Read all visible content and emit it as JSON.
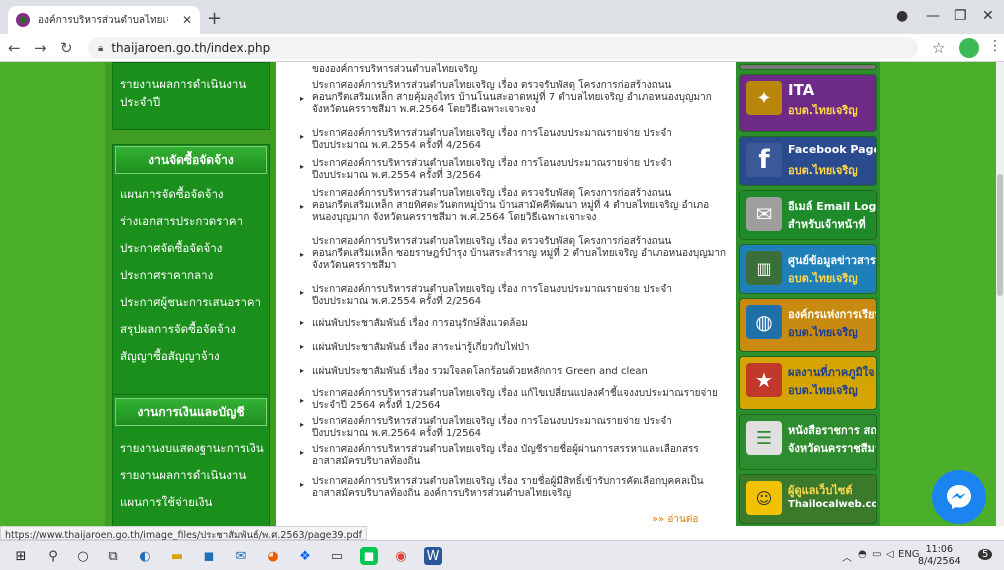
{
  "browser": {
    "tab_title": "องค์การบริหารส่วนตำบลไทยเจริญ อำเ...",
    "url": "thaijaroen.go.th/index.php",
    "hover_link": "https://www.thaijaroen.go.th/image_files/ประชาสัมพันธ์/พ.ศ.2563/page39.pdf"
  },
  "sidebar": {
    "top_item": {
      "line1": "รายงานผลการดำเนินงาน",
      "line2": "ประจำปี"
    },
    "procurement_header": "งานจัดซื้อจัดจ้าง",
    "procurement_items": [
      "แผนการจัดซื้อจัดจ้าง",
      "ร่างเอกสารประกวดราคา",
      "ประกาศจัดซื้อจัดจ้าง",
      "ประกาศราคากลาง",
      "ประกาศผู้ชนะการเสนอราคา",
      "สรุปผลการจัดซื้อจัดจ้าง",
      "สัญญาซื้อสัญญาจ้าง"
    ],
    "finance_header": "งานการเงินและบัญชี",
    "finance_items": [
      "รายงานงบแสดงฐานะการเงิน",
      "รายงานผลการดำเนินงาน",
      "แผนการใช้จ่ายเงิน"
    ]
  },
  "news": {
    "top_line": "ขององค์การบริหารส่วนตำบลไทยเจริญ",
    "items": [
      "ประกาศองค์การบริหารส่วนตำบลไทยเจริญ เรื่อง ตรวจรับพัสดุ โครงการก่อสร้างถนน คอนกรีตเสริมเหล็ก สายคุ้มลุงไทร บ้านโนนสะอาดหมู่ที่ 7 ตำบลไทยเจริญ อำเภอหนองบุญมาก จังหวัดนครราชสีมา พ.ศ.2564 โดยวิธีเฉพาะเจาะจง",
      "ประกาศองค์การบริหารส่วนตำบลไทยเจริญ เรื่อง การโอนงบประมาณรายจ่าย ประจำปีงบประมาณ พ.ศ.2554 ครั้งที่ 4/2564",
      "ประกาศองค์การบริหารส่วนตำบลไทยเจริญ เรื่อง การโอนงบประมาณรายจ่าย ประจำปีงบประมาณ พ.ศ.2554 ครั้งที่ 3/2564",
      "ประกาศองค์การบริหารส่วนตำบลไทยเจริญ เรื่อง ตรวจรับพัสดุ โครงการก่อสร้างถนน คอนกรีตเสริมเหล็ก สายทิศตะวันตกหมู่บ้าน บ้านสามัคคีพัฒนา หมู่ที่ 4 ตำบลไทยเจริญ อำเภอหนองบุญมาก จังหวัดนครราชสีมา พ.ศ.2564 โดยวิธีเฉพาะเจาะจง",
      "ประกาศองค์การบริหารส่วนตำบลไทยเจริญ เรื่อง ตรวจรับพัสดุ โครงการก่อสร้างถนน คอนกรีตเสริมเหล็ก ซอยราษฎร์บำรุง บ้านสระสำราญ หมู่ที่ 2 ตำบลไทยเจริญ อำเภอหนองบุญมาก จังหวัดนครราชสีมา",
      "ประกาศองค์การบริหารส่วนตำบลไทยเจริญ เรื่อง การโอนงบประมาณรายจ่าย ประจำปีงบประมาณ พ.ศ.2554 ครั้งที่ 2/2564",
      "แผ่นพับประชาสัมพันธ์ เรื่อง การอนุรักษ์สิ่งแวดล้อม",
      "แผ่นพับประชาสัมพันธ์ เรื่อง สาระน่ารู้เกี่ยวกับไฟป่า",
      "แผ่นพับประชาสัมพันธ์ เรื่อง รวมใจลดโลกร้อนด้วยหลักการ Green and clean",
      "ประกาศองค์การบริหารส่วนตำบลไทยเจริญ เรื่อง แก้ไขเปลี่ยนแปลงคำชี้แจงงบประมาณรายจ่าย ประจำปี 2564 ครั้งที่ 1/2564",
      "ประกาศองค์การบริหารส่วนตำบลไทยเจริญ เรื่อง การโอนงบประมาณรายจ่าย ประจำปีงบประมาณ พ.ศ.2564 ครั้งที่ 1/2564",
      "ประกาศองค์การบริหารส่วนตำบลไทยเจริญ เรื่อง บัญชีรายชื่อผู้ผ่านการสรรหาและเลือกสรรอาสาสมัครบริบาลท้องถิ่น",
      "ประกาศองค์การบริหารส่วนตำบลไทยเจริญ เรื่อง รายชื่อผู้มีสิทธิ์เข้ารับการคัดเลือกบุคคลเป็นอาสาสมัครบริบาลท้องถิ่น องค์การบริหารส่วนตำบลไทยเจริญ"
    ],
    "read_more": "»» อ่านต่อ"
  },
  "banners": [
    {
      "line1": "ITA",
      "line2": "อบต.ไทยเจริญ",
      "bg": "#6d2a86",
      "icon": "emblem-icon"
    },
    {
      "line1": "Facebook Page",
      "line2": "อบต.ไทยเจริญ",
      "bg": "#2a4c8f",
      "icon": "facebook-icon"
    },
    {
      "line1": "อีเมล์ Email Login",
      "line2": "สำหรับเจ้าหน้าที่",
      "bg": "#1f8a2a",
      "icon": "mail-icon"
    },
    {
      "line1": "ศูนย์ข้อมูลข่าวสาร",
      "line2": "อบต.ไทยเจริญ",
      "bg": "#1f7fb8",
      "icon": "binder-icon"
    },
    {
      "line1": "องค์กรแห่งการเรียนรู้",
      "line2": "อบต.ไทยเจริญ",
      "bg": "#c98a12",
      "icon": "globe-icon"
    },
    {
      "line1": "ผลงานที่ภาคภูมิใจ",
      "line2": "อบต.ไทยเจริญ",
      "bg": "#d4a400",
      "icon": "medal-icon"
    },
    {
      "line1": "หนังสือราชการ สถ.",
      "line2": "จังหวัดนครราชสีมา",
      "bg": "#2e8b2e",
      "icon": "document-icon"
    },
    {
      "line1": "ผู้ดูแลเว็บไซต์",
      "line2": "Thailocalweb.com",
      "bg": "#3a7a2a",
      "icon": "admin-icon"
    }
  ],
  "taskbar": {
    "lang": "ENG",
    "time": "11:06",
    "date": "8/4/2564",
    "notifications": "5"
  }
}
